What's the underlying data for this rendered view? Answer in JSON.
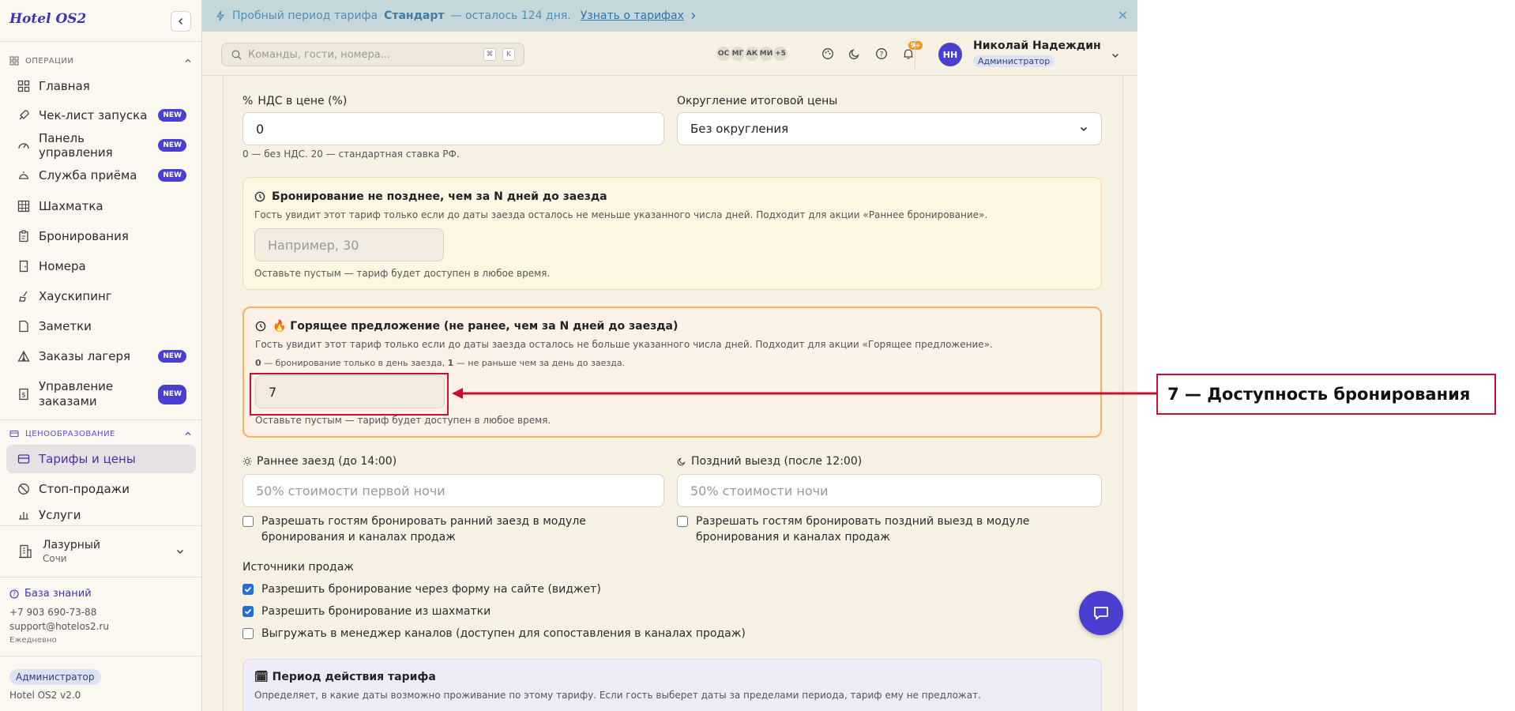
{
  "sidebar": {
    "logo": "Hotel OS2",
    "sections": {
      "operations": "ОПЕРАЦИИ",
      "pricing": "ЦЕНООБРАЗОВАНИЕ"
    },
    "items": [
      {
        "label": "Главная",
        "icon": "home-icon",
        "badge": ""
      },
      {
        "label": "Чек-лист запуска",
        "icon": "rocket-icon",
        "badge": "NEW"
      },
      {
        "label": "Панель управления",
        "icon": "gauge-icon",
        "badge": "NEW"
      },
      {
        "label": "Служба приёма",
        "icon": "bell-concierge-icon",
        "badge": "NEW"
      },
      {
        "label": "Шахматка",
        "icon": "grid-icon",
        "badge": ""
      },
      {
        "label": "Бронирования",
        "icon": "clipboard-icon",
        "badge": ""
      },
      {
        "label": "Номера",
        "icon": "door-icon",
        "badge": ""
      },
      {
        "label": "Хаускипинг",
        "icon": "broom-icon",
        "badge": ""
      },
      {
        "label": "Заметки",
        "icon": "note-icon",
        "badge": ""
      },
      {
        "label": "Заказы лагеря",
        "icon": "tent-icon",
        "badge": "NEW"
      },
      {
        "label": "Управление заказами",
        "icon": "receipt-icon",
        "badge": "NEW"
      }
    ],
    "pricing_items": [
      {
        "label": "Тарифы и цены",
        "icon": "card-icon"
      },
      {
        "label": "Стоп-продажи",
        "icon": "ban-icon"
      },
      {
        "label": "Услуги",
        "icon": "services-icon"
      }
    ],
    "hotel": {
      "name": "Лазурный",
      "city": "Сочи"
    },
    "knowledge_base": "База знаний",
    "phone": "+7 903 690-73-88",
    "email": "support@hotelos2.ru",
    "schedule": "Ежедневно",
    "role": "Администратор",
    "version": "Hotel OS2 v2.0"
  },
  "banner": {
    "prefix": "Пробный период тарифа",
    "plan": "Стандарт",
    "suffix": "— осталось 124 дня.",
    "link": "Узнать о тарифах"
  },
  "header": {
    "search_placeholder": "Команды, гости, номера...",
    "kbd1": "⌘",
    "kbd2": "K",
    "avatars": [
      "ОС",
      "МГ",
      "АК",
      "МИ",
      "+5"
    ],
    "notif_count": "9+",
    "user_initials": "НН",
    "user_name": "Николай Надеждин",
    "user_role": "Администратор"
  },
  "form": {
    "vat_label": "НДС в цене (%)",
    "vat_value": "0",
    "vat_help": "0 — без НДС. 20 — стандартная ставка РФ.",
    "rounding_label": "Округление итоговой цены",
    "rounding_value": "Без округления",
    "early": {
      "title": "Бронирование не позднее, чем за N дней до заезда",
      "desc": "Гость увидит этот тариф только если до даты заезда осталось не меньше указанного числа дней. Подходит для акции «Раннее бронирование».",
      "placeholder": "Например, 30",
      "help": "Оставьте пустым — тариф будет доступен в любое время."
    },
    "hot": {
      "title": "🔥 Горящее предложение (не ранее, чем за N дней до заезда)",
      "desc": "Гость увидит этот тариф только если до даты заезда осталось не больше указанного числа дней. Подходит для акции «Горящее предложение».",
      "hint_zero": "0",
      "hint_zero_text": "— бронирование только в день заезда,",
      "hint_one": "1",
      "hint_one_text": "— не раньше чем за день до заезда.",
      "value": "7",
      "help": "Оставьте пустым — тариф будет доступен в любое время."
    },
    "early_checkin_label": "Раннее заезд (до 14:00)",
    "early_checkin_placeholder": "50% стоимости первой ночи",
    "late_checkout_label": "Поздний выезд (после 12:00)",
    "late_checkout_placeholder": "50% стоимости ночи",
    "allow_early": "Разрешать гостям бронировать ранний заезд в модуле бронирования и каналах продаж",
    "allow_late": "Разрешать гостям бронировать поздний выезд в модуле бронирования и каналах продаж",
    "sources_label": "Источники продаж",
    "sources": [
      {
        "label": "Разрешить бронирование через форму на сайте (виджет)",
        "checked": true
      },
      {
        "label": "Разрешить бронирование из шахматки",
        "checked": true
      },
      {
        "label": "Выгружать в менеджер каналов (доступен для сопоставления в каналах продаж)",
        "checked": false
      }
    ],
    "period_title": "🗓 Период действия тарифа",
    "period_desc": "Определяет, в какие даты возможно проживание по этому тарифу. Если гость выберет даты за пределами периода, тариф ему не предложат."
  },
  "annotation": {
    "callout": "7 — Доступность бронирования",
    "color": "#c8102e"
  }
}
